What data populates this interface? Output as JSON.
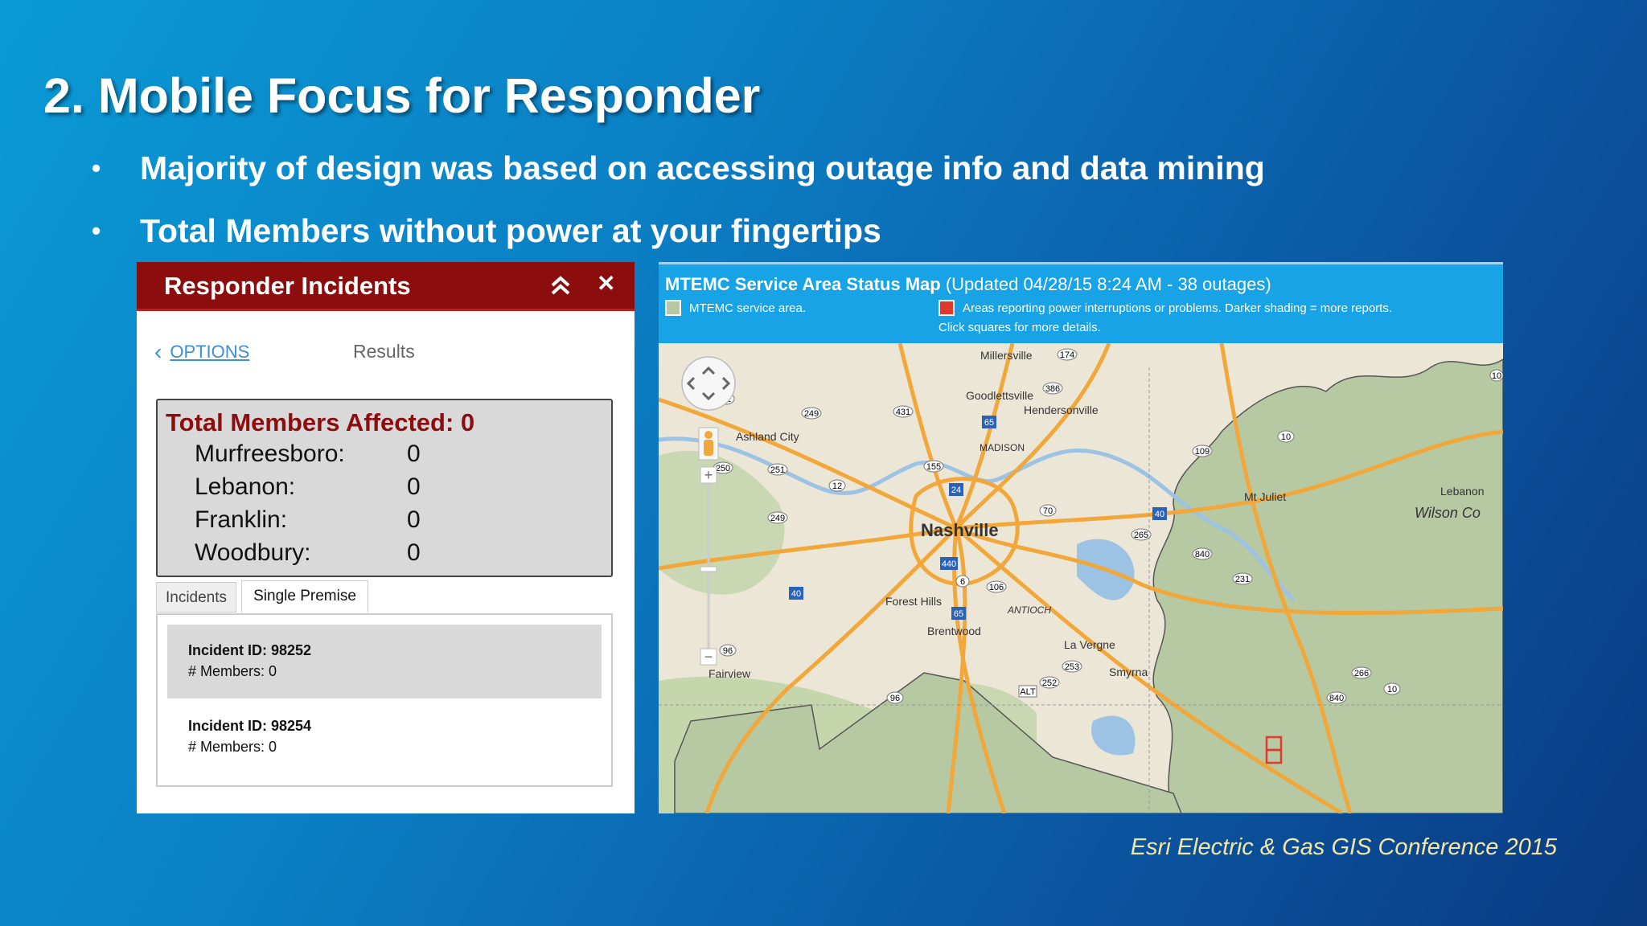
{
  "slide": {
    "title": "2.  Mobile Focus for Responder",
    "bullets": [
      "Majority of design was based on accessing outage info and data mining",
      "Total Members without power at your fingertips"
    ],
    "bullet_symbol": "•",
    "footer": "Esri Electric & Gas GIS Conference 2015"
  },
  "panel": {
    "title": "Responder Incidents",
    "close_symbol": "✕",
    "options_label": "OPTIONS",
    "results_label": "Results",
    "total_label": "Total Members Affected: 0",
    "areas": [
      {
        "name": "Murfreesboro:",
        "value": "0"
      },
      {
        "name": "Lebanon:",
        "value": "0"
      },
      {
        "name": "Franklin:",
        "value": "0"
      },
      {
        "name": "Woodbury:",
        "value": "0"
      }
    ],
    "tabs": [
      "Incidents",
      "Single Premise"
    ],
    "incidents": [
      {
        "id": "Incident ID: 98252",
        "members": "# Members: 0"
      },
      {
        "id": "Incident ID: 98254",
        "members": "# Members: 0"
      }
    ]
  },
  "map": {
    "title_bold": "MTEMC Service Area Status Map",
    "title_rest": " (Updated 04/28/15 8:24 AM - 38 outages)",
    "legend_service": "MTEMC service area.",
    "legend_outage": "Areas reporting power interruptions or problems. Darker shading = more reports.",
    "legend_outage_2": "Click squares for more details.",
    "zoom_in": "+",
    "zoom_out": "−",
    "places": {
      "millersville": "Millersville",
      "goodlettsville": "Goodlettsville",
      "hendersonville": "Hendersonville",
      "ashland_city": "Ashland City",
      "madison": "MADISON",
      "nashville": "Nashville",
      "mt_juliet": "Mt Juliet",
      "lebanon": "Lebanon",
      "wilson_co": "Wilson Co",
      "forest_hills": "Forest Hills",
      "antioch": "ANTIOCH",
      "brentwood": "Brentwood",
      "la_vergne": "La Vergne",
      "smyrna": "Smyrna",
      "fairview": "Fairview"
    },
    "route_shields": [
      "174",
      "386",
      "431",
      "249",
      "65",
      "12",
      "10",
      "109",
      "250",
      "251",
      "155",
      "24",
      "12",
      "70",
      "249",
      "40",
      "265",
      "840",
      "231",
      "440",
      "106",
      "6",
      "40",
      "65",
      "253",
      "252",
      "266",
      "10",
      "96",
      "96",
      "840",
      "ALT",
      "10"
    ],
    "colors": {
      "service_area": "#b7c9a2",
      "header": "#17a3e6",
      "highway": "#f2a73b",
      "outage": "#e03a2c"
    }
  }
}
